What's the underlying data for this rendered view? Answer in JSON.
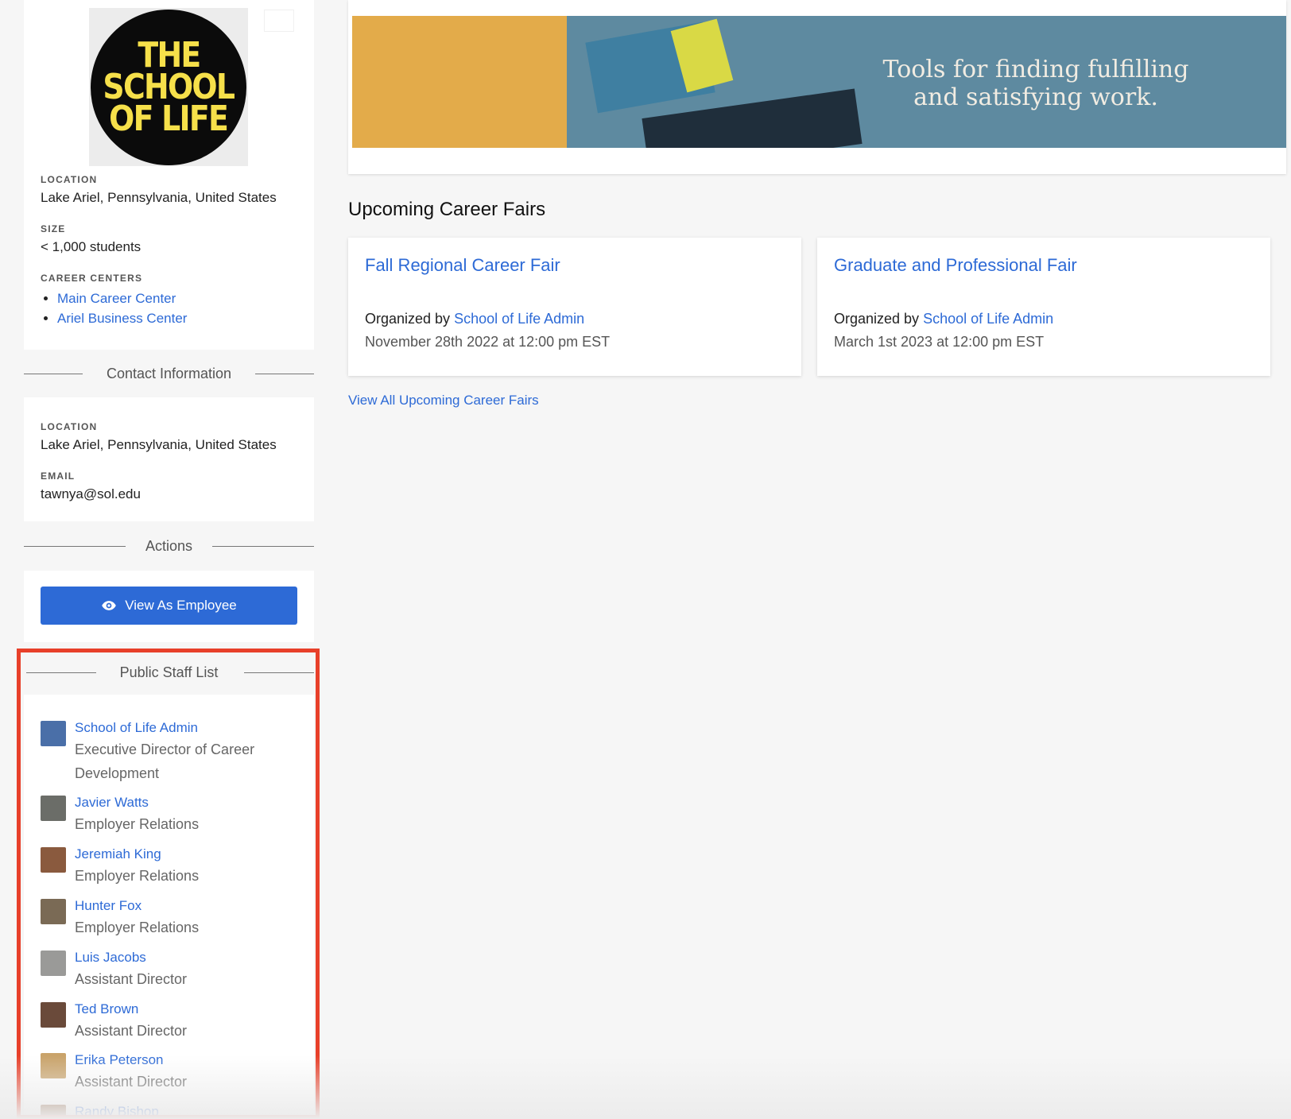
{
  "profile": {
    "logo_lines": [
      "THE",
      "SCHOOL",
      "OF LIFE"
    ],
    "location_label": "LOCATION",
    "location": "Lake Ariel, Pennsylvania, United States",
    "size_label": "SIZE",
    "size": "< 1,000 students",
    "career_centers_label": "CAREER CENTERS",
    "career_centers": [
      "Main Career Center",
      "Ariel Business Center"
    ]
  },
  "contact": {
    "heading": "Contact Information",
    "location_label": "LOCATION",
    "location": "Lake Ariel, Pennsylvania, United States",
    "email_label": "EMAIL",
    "email": "tawnya@sol.edu"
  },
  "actions": {
    "heading": "Actions",
    "view_as_employee": "View As Employee",
    "button_icon": "eye-icon"
  },
  "staff": {
    "heading": "Public Staff List",
    "members": [
      {
        "name": "School of Life Admin",
        "title": "Executive Director of Career Development",
        "avatar_color": "#4a6fa8"
      },
      {
        "name": "Javier Watts",
        "title": "Employer Relations",
        "avatar_color": "#6b6d68"
      },
      {
        "name": "Jeremiah King",
        "title": "Employer Relations",
        "avatar_color": "#8a5a3e"
      },
      {
        "name": "Hunter Fox",
        "title": "Employer Relations",
        "avatar_color": "#7a6a55"
      },
      {
        "name": "Luis Jacobs",
        "title": "Assistant Director",
        "avatar_color": "#9a9a98"
      },
      {
        "name": "Ted Brown",
        "title": "Assistant Director",
        "avatar_color": "#6a4a3a"
      },
      {
        "name": "Erika Peterson",
        "title": "Assistant Director",
        "avatar_color": "#c9a36a"
      },
      {
        "name": "Randy Bishop",
        "title": "",
        "avatar_color": "#8a5a3a"
      }
    ]
  },
  "banner": {
    "tagline_line1": "Tools for finding fulfilling",
    "tagline_line2": "and satisfying work."
  },
  "fairs": {
    "heading": "Upcoming Career Fairs",
    "organized_by_label": "Organized by",
    "items": [
      {
        "title": "Fall Regional Career Fair",
        "organizer": "School of Life Admin",
        "date": "November 28th 2022 at 12:00 pm EST"
      },
      {
        "title": "Graduate and Professional Fair",
        "organizer": "School of Life Admin",
        "date": "March 1st 2023 at 12:00 pm EST"
      }
    ],
    "view_all": "View All Upcoming Career Fairs"
  },
  "colors": {
    "link": "#2d6ad6",
    "primary_button": "#2d6ad6",
    "highlight_border": "#e8402a",
    "logo_yellow": "#f6e04a"
  }
}
